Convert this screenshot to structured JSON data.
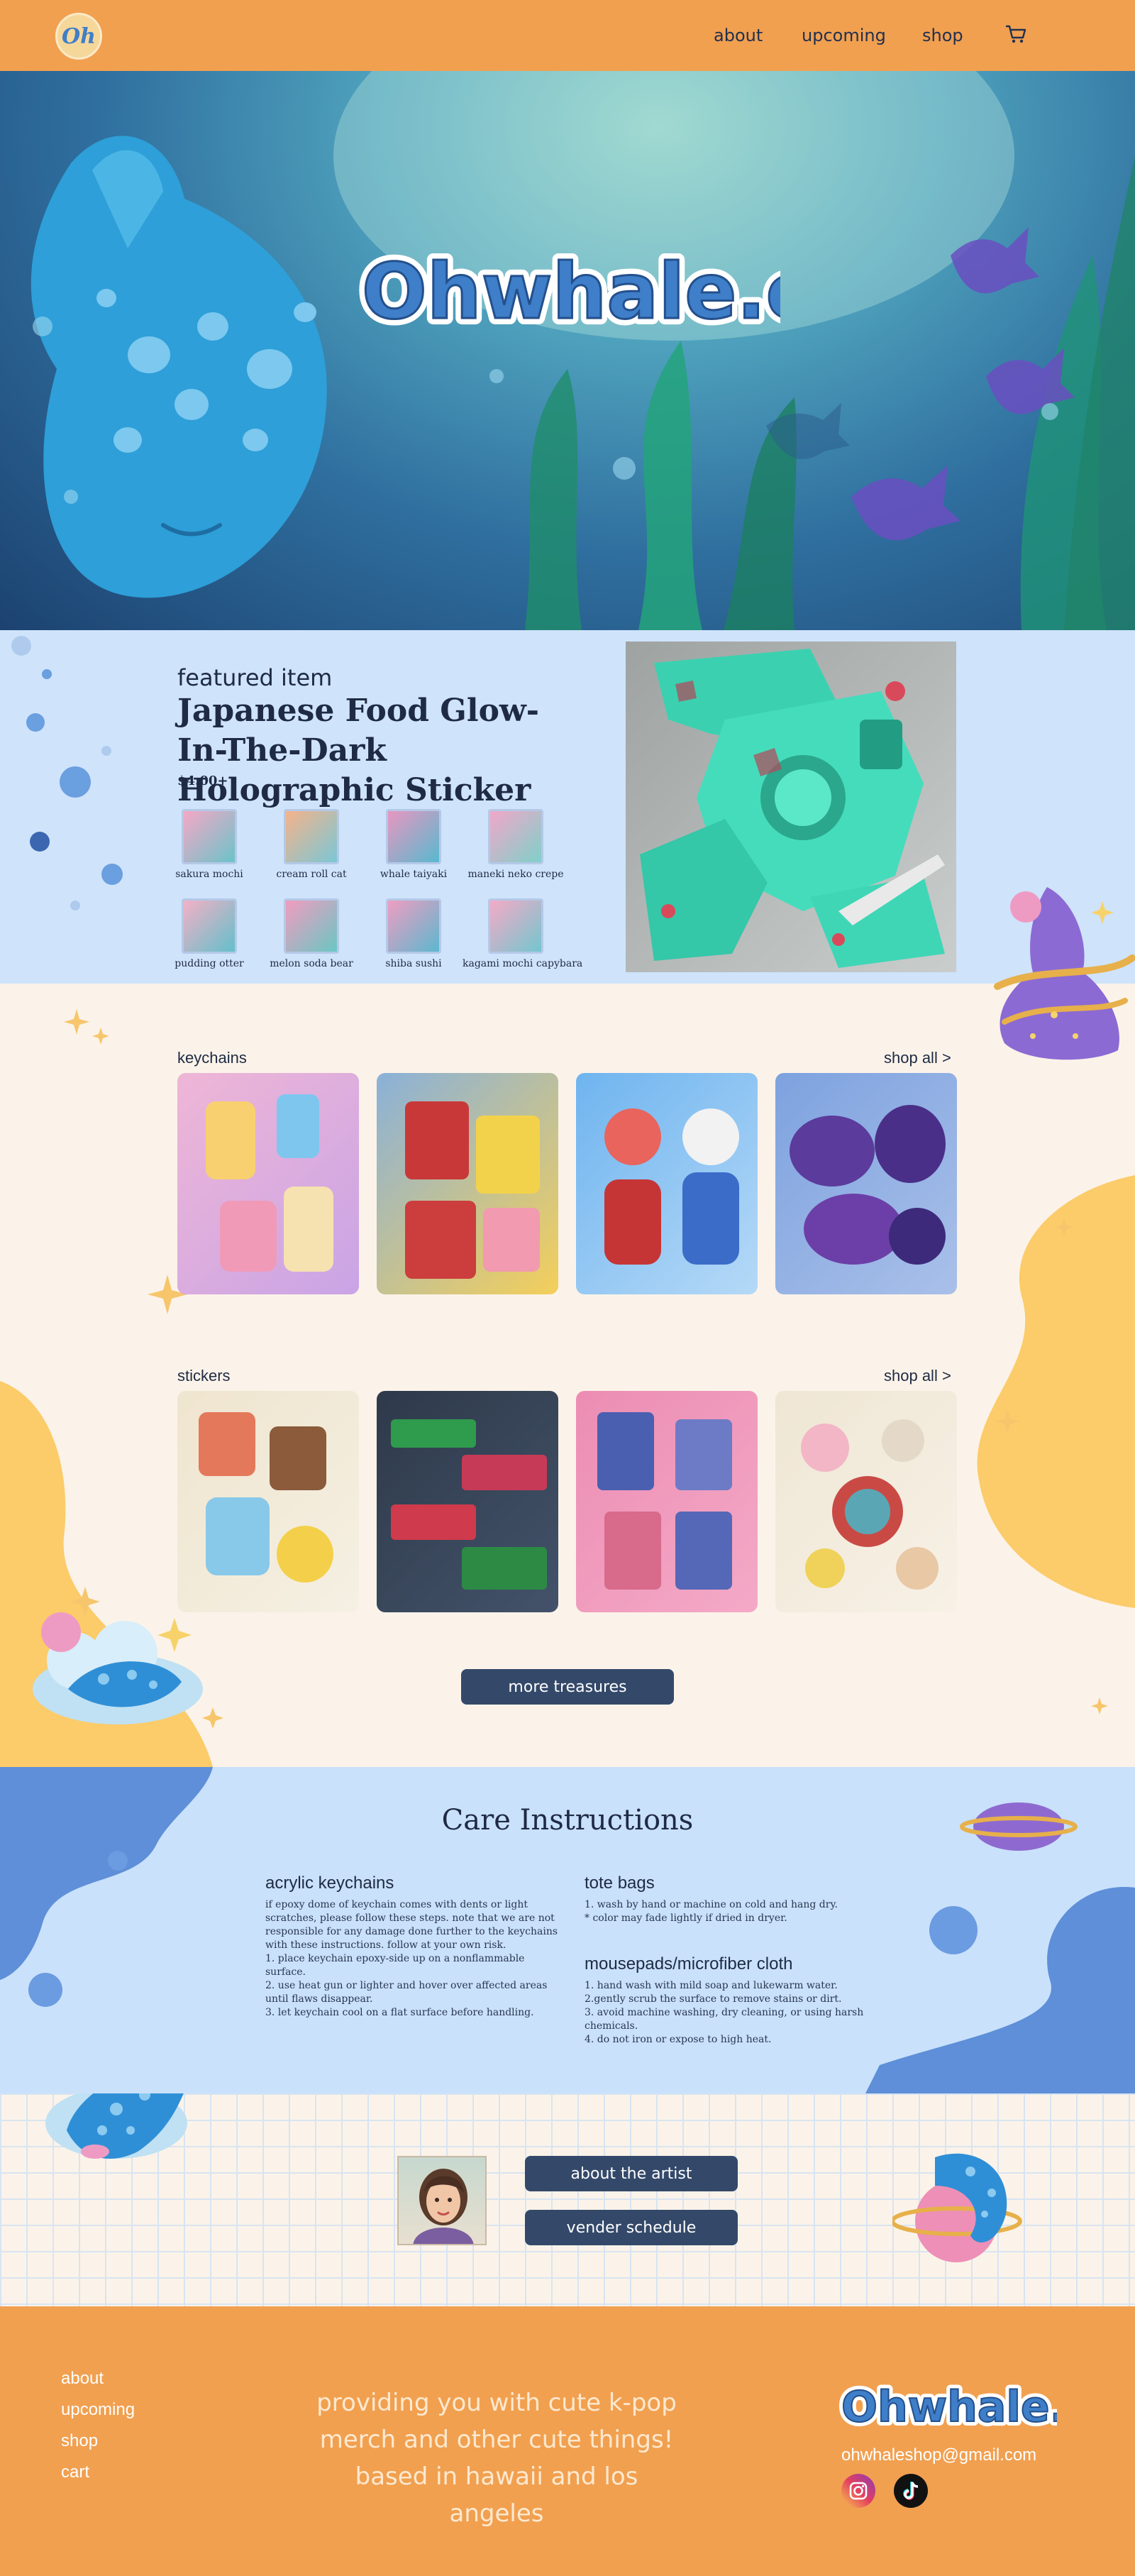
{
  "nav": {
    "logo_text": "Oh",
    "links": [
      "about",
      "upcoming",
      "shop"
    ],
    "cart_icon": "cart-icon"
  },
  "hero": {
    "wordmark": "Ohwhale.co"
  },
  "featured": {
    "eyebrow": "featured item",
    "title": "Japanese Food Glow-In-The-Dark Holographic Sticker",
    "price": "$4.00+",
    "variants": [
      "sakura mochi",
      "cream roll cat",
      "whale taiyaki",
      "maneki neko crepe",
      "pudding otter",
      "melon soda bear",
      "shiba sushi",
      "kagami mochi capybara"
    ]
  },
  "keychains": {
    "title": "keychains",
    "shop_all": "shop all >"
  },
  "stickers": {
    "title": "stickers",
    "shop_all": "shop all >"
  },
  "more_button": "more treasures",
  "care": {
    "title": "Care Instructions",
    "acrylic": {
      "heading": "acrylic keychains",
      "body": "if epoxy dome of keychain comes with dents or light\nscratches, please follow these steps. note that we are not\nresponsible for any damage done further to the keychains\nwith these instructions. follow at your own risk.\n1. place keychain epoxy-side up on a nonflammable\nsurface.\n2. use heat gun or lighter and hover over affected areas\nuntil flaws disappear.\n3. let keychain cool on a flat surface before handling."
    },
    "tote": {
      "heading": "tote bags",
      "body": "1. wash by hand or machine on cold and hang dry.\n* color may fade lightly if dried in dryer."
    },
    "mousepad": {
      "heading": "mousepads/microfiber cloth",
      "body": "1. hand wash with mild soap and lukewarm water.\n2.gently scrub the surface to remove stains or dirt.\n3. avoid machine washing, dry cleaning, or using harsh\nchemicals.\n4. do not iron or expose to high heat."
    }
  },
  "artist": {
    "about_button": "about the artist",
    "schedule_button": "vender schedule"
  },
  "footer": {
    "links": [
      "about",
      "upcoming",
      "shop",
      "cart"
    ],
    "tagline": "providing you with cute k-pop\nmerch and other cute things!\nbased in hawaii and los angeles",
    "wordmark": "Ohwhale.co",
    "email": "ohwhaleshop@gmail.com",
    "social_icons": [
      "instagram-icon",
      "tiktok-icon"
    ]
  },
  "colors": {
    "orange": "#f1a050",
    "cream": "#fbf3e9",
    "light_blue": "#cfe3fb",
    "navy_button": "#34496a",
    "yellow_blob": "#fccb6a",
    "blue_blob": "#5e97db"
  }
}
